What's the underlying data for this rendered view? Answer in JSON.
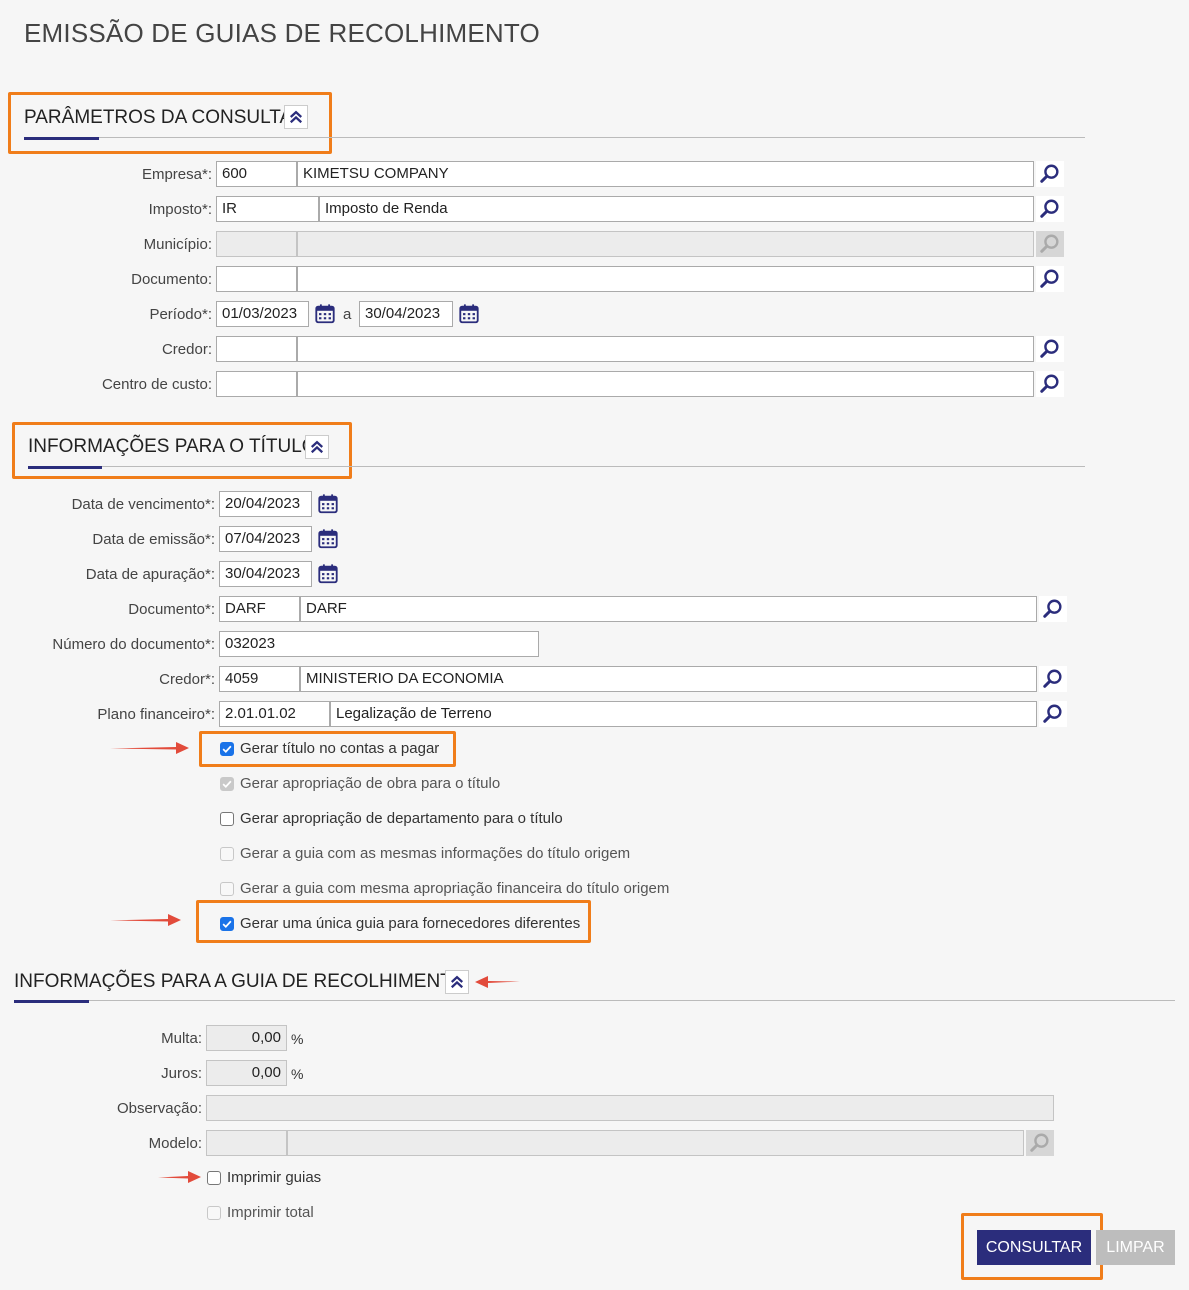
{
  "page": {
    "title": "EMISSÃO DE GUIAS DE RECOLHIMENTO"
  },
  "colors": {
    "accent": "#2b2d7c",
    "highlight": "#f07d1a",
    "arrow": "#e24b3b",
    "checkbox": "#1a73e8"
  },
  "section1": {
    "title": "PARÂMETROS DA CONSULTA",
    "empresa": {
      "label": "Empresa*:",
      "code": "600",
      "name": "KIMETSU COMPANY"
    },
    "imposto": {
      "label": "Imposto*:",
      "code": "IR",
      "name": "Imposto de Renda"
    },
    "municipio": {
      "label": "Município:",
      "code": "",
      "name": ""
    },
    "documento": {
      "label": "Documento:",
      "code": "",
      "name": ""
    },
    "periodo": {
      "label": "Período*:",
      "from": "01/03/2023",
      "separator": "a",
      "to": "30/04/2023"
    },
    "credor": {
      "label": "Credor:",
      "code": "",
      "name": ""
    },
    "centro_custo": {
      "label": "Centro de custo:",
      "code": "",
      "name": ""
    }
  },
  "section2": {
    "title": "INFORMAÇÕES PARA O TÍTULO",
    "data_vencimento": {
      "label": "Data de vencimento*:",
      "value": "20/04/2023"
    },
    "data_emissao": {
      "label": "Data de emissão*:",
      "value": "07/04/2023"
    },
    "data_apuracao": {
      "label": "Data de apuração*:",
      "value": "30/04/2023"
    },
    "documento": {
      "label": "Documento*:",
      "code": "DARF",
      "name": "DARF"
    },
    "numero_documento": {
      "label": "Número do documento*:",
      "value": "032023"
    },
    "credor": {
      "label": "Credor*:",
      "code": "4059",
      "name": "MINISTERIO DA ECONOMIA"
    },
    "plano_financeiro": {
      "label": "Plano financeiro*:",
      "code": "2.01.01.02",
      "name": "Legalização de Terreno"
    },
    "checkboxes": [
      {
        "label": "Gerar título no contas a pagar",
        "checked": true,
        "disabled": false
      },
      {
        "label": "Gerar apropriação de obra para o título",
        "checked": true,
        "disabled": true
      },
      {
        "label": "Gerar apropriação de departamento para o título",
        "checked": false,
        "disabled": false
      },
      {
        "label": "Gerar a guia com as mesmas informações do título origem",
        "checked": false,
        "disabled": true
      },
      {
        "label": "Gerar a guia com mesma apropriação financeira do título origem",
        "checked": false,
        "disabled": true
      },
      {
        "label": "Gerar uma única guia para fornecedores diferentes",
        "checked": true,
        "disabled": false
      }
    ]
  },
  "section3": {
    "title": "INFORMAÇÕES PARA A GUIA DE RECOLHIMENTO",
    "multa": {
      "label": "Multa:",
      "value": "0,00",
      "unit": "%"
    },
    "juros": {
      "label": "Juros:",
      "value": "0,00",
      "unit": "%"
    },
    "observacao": {
      "label": "Observação:",
      "value": ""
    },
    "modelo": {
      "label": "Modelo:",
      "code": "",
      "name": ""
    },
    "checkboxes": [
      {
        "label": "Imprimir guias",
        "checked": false,
        "disabled": false
      },
      {
        "label": "Imprimir total",
        "checked": false,
        "disabled": true
      }
    ]
  },
  "actions": {
    "consultar": "CONSULTAR",
    "limpar": "LIMPAR"
  }
}
